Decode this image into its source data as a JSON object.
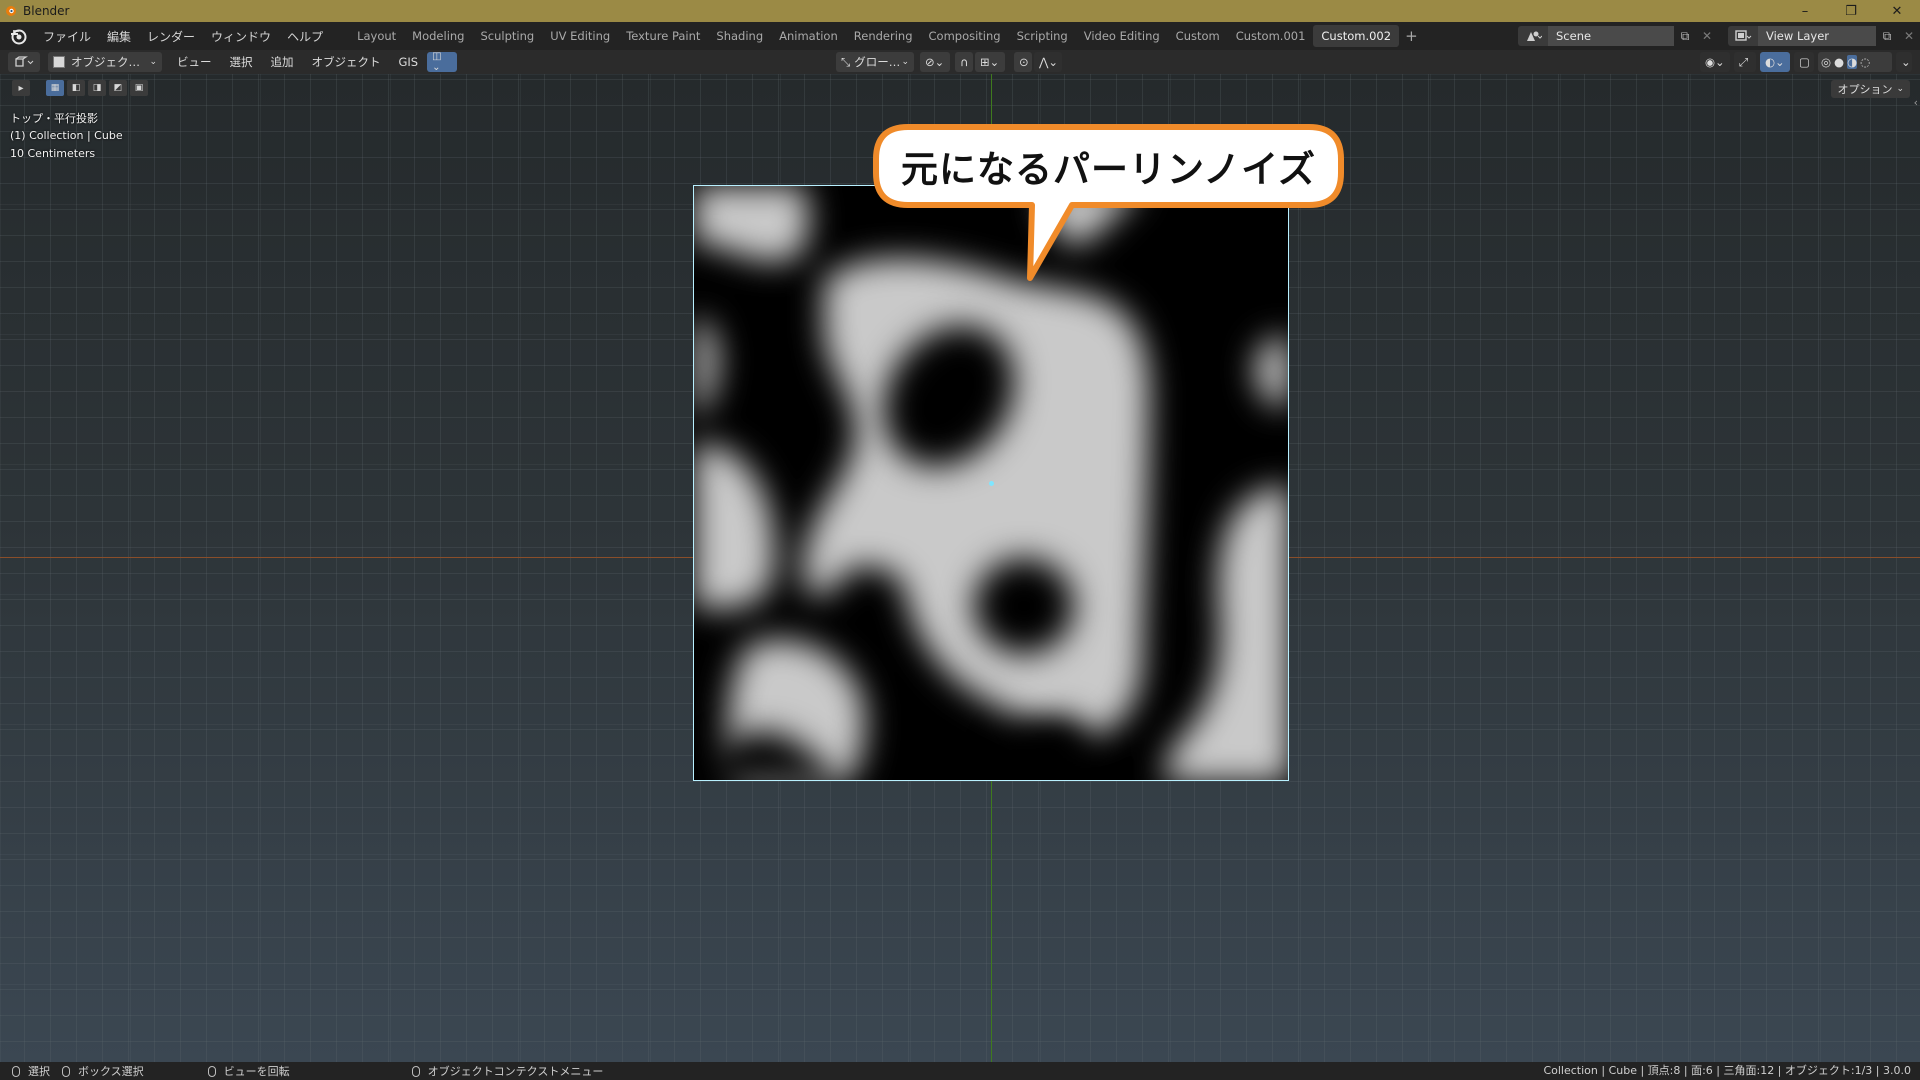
{
  "window": {
    "title": "Blender"
  },
  "menu": [
    "ファイル",
    "編集",
    "レンダー",
    "ウィンドウ",
    "ヘルプ"
  ],
  "workspaces": [
    "Layout",
    "Modeling",
    "Sculpting",
    "UV Editing",
    "Texture Paint",
    "Shading",
    "Animation",
    "Rendering",
    "Compositing",
    "Scripting",
    "Video Editing",
    "Custom",
    "Custom.001",
    "Custom.002"
  ],
  "active_workspace": "Custom.002",
  "scene": {
    "value": "Scene",
    "view_layer": "View Layer"
  },
  "viewport_header": {
    "mode": "オブジェク…",
    "menus": [
      "ビュー",
      "選択",
      "追加",
      "オブジェクト",
      "GIS"
    ],
    "transform_orientation": "グロー…"
  },
  "viewport": {
    "view_name": "トップ・平行投影",
    "collection_info": "(1) Collection | Cube",
    "grid_scale": "10 Centimeters",
    "options_label": "オプション"
  },
  "callout": {
    "text": "元になるパーリンノイズ",
    "border_color": "#f08b2a"
  },
  "statusbar": {
    "select": "選択",
    "box_select": "ボックス選択",
    "rotate_view": "ビューを回転",
    "context_menu": "オブジェクトコンテクストメニュー",
    "stats": "Collection | Cube | 頂点:8 | 面:6 | 三角面:12 | オブジェクト:1/3 | 3.0.0"
  }
}
